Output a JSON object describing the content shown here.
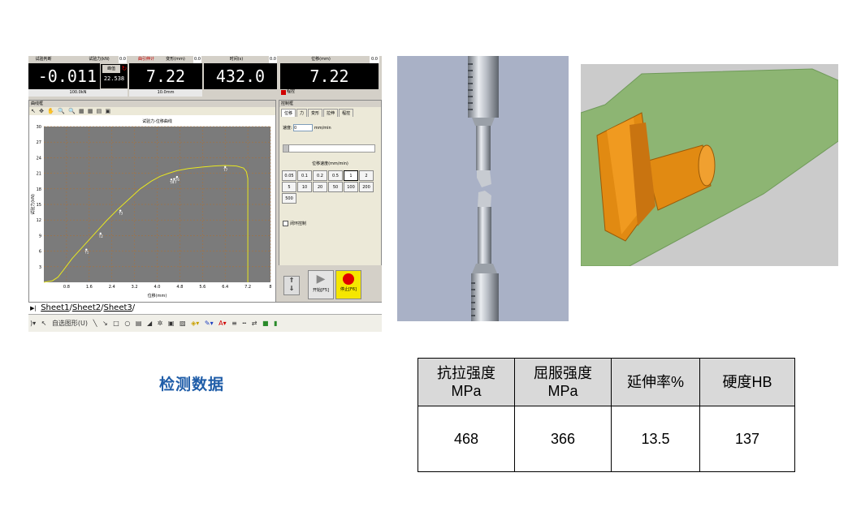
{
  "software": {
    "displays": [
      {
        "title": "试验判断",
        "value": "",
        "footer": ""
      },
      {
        "title": "试验力(kN)",
        "value": "-0.011",
        "footer": "100.0kN",
        "badge": "0.0"
      },
      {
        "title": "曲引伸计",
        "subtitle": "变形(mm)",
        "value": "7.22",
        "footer": "10.0mm",
        "badge": "0.0"
      },
      {
        "title": "时间(s)",
        "value": "432.0",
        "footer": "",
        "badge": "0.0"
      },
      {
        "title": "位移(mm)",
        "value": "7.22",
        "footer": "",
        "badge": "0.0"
      }
    ],
    "peak": {
      "label": "峰值",
      "value": "22.538"
    },
    "operation_label": "程控",
    "chart_panel": {
      "caption": "曲线框",
      "title": "试验力-位移曲线",
      "tools": "↖ ✥ ✋ 🔍 🔍 ▦ ▦ ▤ ▣"
    },
    "control_panel": {
      "caption": "控制框",
      "tabs": [
        "位移",
        "力",
        "变形",
        "拉伸",
        "程控"
      ],
      "speed_label": "速度:",
      "speed_value": "0",
      "speed_unit": "mm/min",
      "group_label": "位移速度(mm/min)",
      "speed_buttons": [
        "0.05",
        "0.1",
        "0.2",
        "0.5",
        "1",
        "2",
        "5",
        "10",
        "20",
        "50",
        "100",
        "200",
        "500"
      ],
      "selected_speed": "1",
      "closed_loop_label": "闭环控制",
      "start_label": "开始[F5]",
      "stop_label": "停止[F6]"
    },
    "sheet_tabs": [
      "Sheet1",
      "Sheet2",
      "Sheet3"
    ],
    "draw_toolbar": {
      "autoshape_label": "自选图形(U)"
    }
  },
  "chart_data": {
    "type": "line",
    "title": "试验力-位移曲线",
    "xlabel": "位移(mm)",
    "ylabel": "试验力(kN)",
    "xlim": [
      0,
      8
    ],
    "ylim": [
      0,
      30
    ],
    "xticks": [
      "0.8",
      "1.6",
      "2.4",
      "3.2",
      "4.0",
      "4.8",
      "5.6",
      "6.4",
      "7.2",
      "8"
    ],
    "yticks": [
      "3",
      "6",
      "9",
      "12",
      "15",
      "18",
      "21",
      "24",
      "27",
      "30"
    ],
    "grid": true,
    "series": [
      {
        "color": "#e8e820",
        "x": [
          0,
          0.3,
          0.5,
          0.7,
          1.0,
          1.4,
          1.8,
          2.2,
          2.6,
          3.0,
          3.4,
          3.8,
          4.1,
          4.4,
          4.7,
          5.1,
          5.6,
          6.0,
          6.4,
          6.8,
          7.05,
          7.15,
          7.2,
          7.2
        ],
        "y": [
          0,
          0.3,
          1.0,
          2.4,
          4.6,
          7.0,
          9.4,
          11.8,
          14.0,
          16.0,
          18.0,
          19.5,
          20.4,
          21.0,
          21.5,
          21.9,
          22.2,
          22.4,
          22.5,
          22.4,
          22.0,
          21.3,
          20.0,
          0
        ]
      }
    ],
    "markers": [
      {
        "label": "T1",
        "x": 1.5,
        "y": 6.3
      },
      {
        "label": "T2",
        "x": 2.0,
        "y": 9.4
      },
      {
        "label": "T3",
        "x": 2.7,
        "y": 13.8
      },
      {
        "label": "T4",
        "x": 4.5,
        "y": 19.8
      },
      {
        "label": "T5",
        "x": 4.6,
        "y": 19.9
      },
      {
        "label": "T6",
        "x": 4.7,
        "y": 20.3
      },
      {
        "label": "T7",
        "x": 6.4,
        "y": 22.2
      }
    ]
  },
  "section_title": "检测数据",
  "results_table": {
    "headers": [
      {
        "line1": "抗拉强度",
        "line2": "MPa"
      },
      {
        "line1": "屈服强度",
        "line2": "MPa"
      },
      {
        "line1": "延伸率%",
        "line2": ""
      },
      {
        "line1": "硬度HB",
        "line2": ""
      }
    ],
    "values": [
      "468",
      "366",
      "13.5",
      "137"
    ]
  },
  "colors": {
    "title_blue": "#1f5da8",
    "header_gray": "#d9d9d9",
    "plot_bg": "#7b7b7b",
    "curve_yellow": "#e8e820",
    "model_green": "#8db573",
    "model_orange": "#e18a12"
  }
}
